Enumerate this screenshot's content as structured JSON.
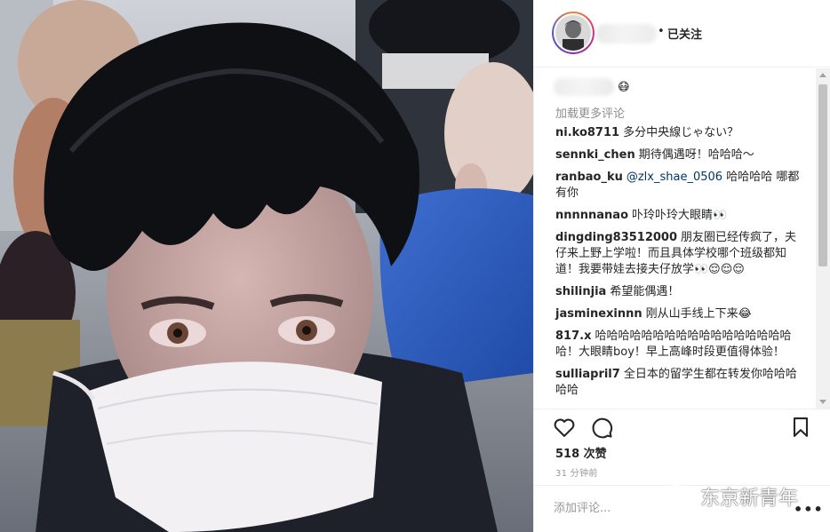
{
  "header": {
    "follow_status": "已关注",
    "separator": "•"
  },
  "caption": {
    "emoji": "😷"
  },
  "comments_section": {
    "load_more_label": "加载更多评论",
    "items": [
      {
        "user": "ni.ko8711",
        "text": "多分中央線じゃない？"
      },
      {
        "user": "sennki_chen",
        "text": "期待偶遇呀！哈哈哈～"
      },
      {
        "user": "ranbao_ku",
        "mention": "@zlx_shae_0506",
        "text": "哈哈哈哈 哪都有你"
      },
      {
        "user": "nnnnnanao",
        "text": "卟玲卟玲大眼睛👀"
      },
      {
        "user": "dingding83512000",
        "text": "朋友圈已经传疯了，夫仔来上野上学啦！而且具体学校哪个班级都知道！我要带娃去接夫仔放学👀😌😌😌"
      },
      {
        "user": "shilinjia",
        "text": "希望能偶遇！"
      },
      {
        "user": "jasminexinnn",
        "text": "刚从山手线上下来😂"
      },
      {
        "user": "817.x",
        "text": "哈哈哈哈哈哈哈哈哈哈哈哈哈哈哈哈哈哈！大眼睛boy！早上高峰时段更值得体验！"
      },
      {
        "user": "sulliapril7",
        "text": "全日本的留学生都在转发你哈哈哈哈哈"
      }
    ]
  },
  "actions": {
    "like_icon": "heart-outline-icon",
    "comment_icon": "speech-bubble-icon",
    "save_icon": "bookmark-icon"
  },
  "likes_label": "518 次赞",
  "timestamp": "31 分钟前",
  "add_comment": {
    "placeholder": "添加评论...",
    "more_label": "•••"
  },
  "watermark": {
    "text": "东京新青年"
  },
  "colors": {
    "mention": "#003569",
    "muted": "#8e8e8e",
    "divider": "#efefef",
    "text": "#262626"
  }
}
